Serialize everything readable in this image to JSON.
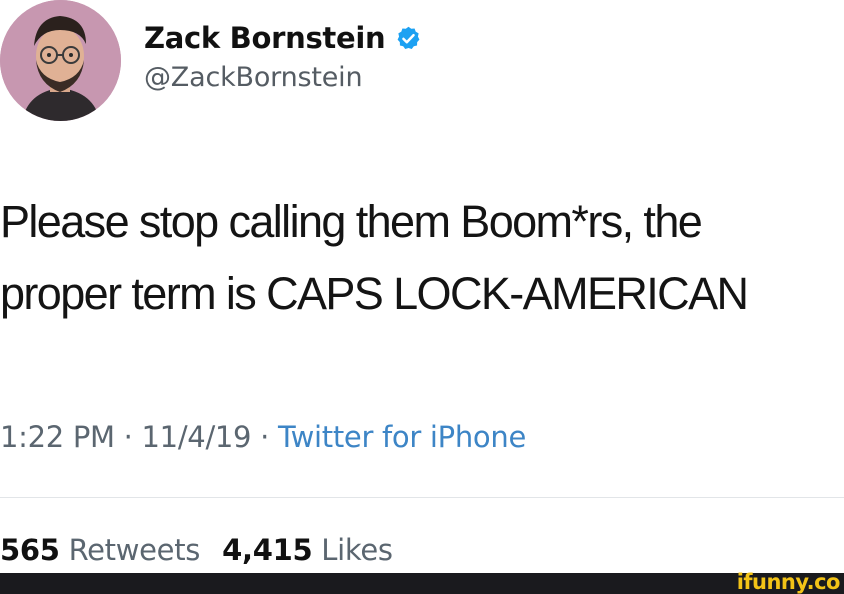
{
  "author": {
    "display_name": "Zack Bornstein",
    "handle": "@ZackBornstein",
    "verified_icon": "verified-badge-icon"
  },
  "tweet": {
    "lines": [
      "Please stop calling them Boom*rs, the",
      "proper term is CAPS LOCK-AMERICAN"
    ]
  },
  "meta": {
    "time": "1:22 PM",
    "sep1": " · ",
    "date": "11/4/19",
    "sep2": " · ",
    "source": "Twitter for iPhone"
  },
  "stats": {
    "retweets_count": "565",
    "retweets_label": "Retweets",
    "likes_count": "4,415",
    "likes_label": "Likes"
  },
  "watermark": {
    "text": "ifunny.co"
  },
  "colors": {
    "link_blue": "#3d85c6",
    "muted_gray": "#5b6670",
    "verified_blue": "#1da1f2",
    "watermark_yellow": "#f3c317",
    "watermark_bar": "#1a1a1e"
  }
}
